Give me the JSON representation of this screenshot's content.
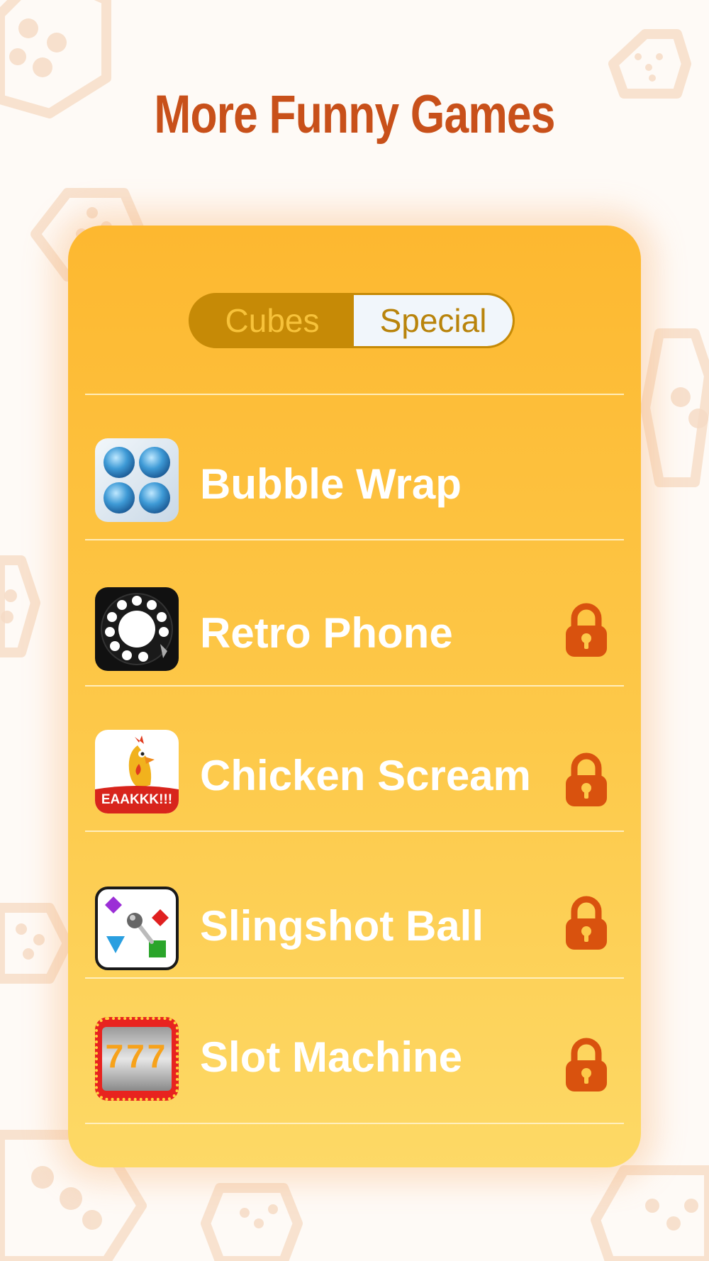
{
  "header": {
    "title": "More Funny Games"
  },
  "tabs": [
    {
      "label": "Cubes",
      "selected": false
    },
    {
      "label": "Special",
      "selected": true
    }
  ],
  "games": [
    {
      "name": "Bubble Wrap",
      "icon": "bubble-wrap-icon",
      "locked": false
    },
    {
      "name": "Retro Phone",
      "icon": "rotary-phone-icon",
      "locked": true
    },
    {
      "name": "Chicken Scream",
      "icon": "rubber-chicken-icon",
      "locked": true,
      "icon_text": "EAAKKK!!!"
    },
    {
      "name": "Slingshot Ball",
      "icon": "slingshot-ball-icon",
      "locked": true
    },
    {
      "name": "Slot Machine",
      "icon": "slot-machine-icon",
      "locked": true,
      "icon_text": "777"
    }
  ],
  "colors": {
    "title": "#c8501a",
    "card_top": "#fdb830",
    "card_bottom": "#fdd966",
    "lock": "#d9520e",
    "tab_active_bg": "#f1f6fb",
    "tab_inactive_bg": "#c68a06"
  }
}
